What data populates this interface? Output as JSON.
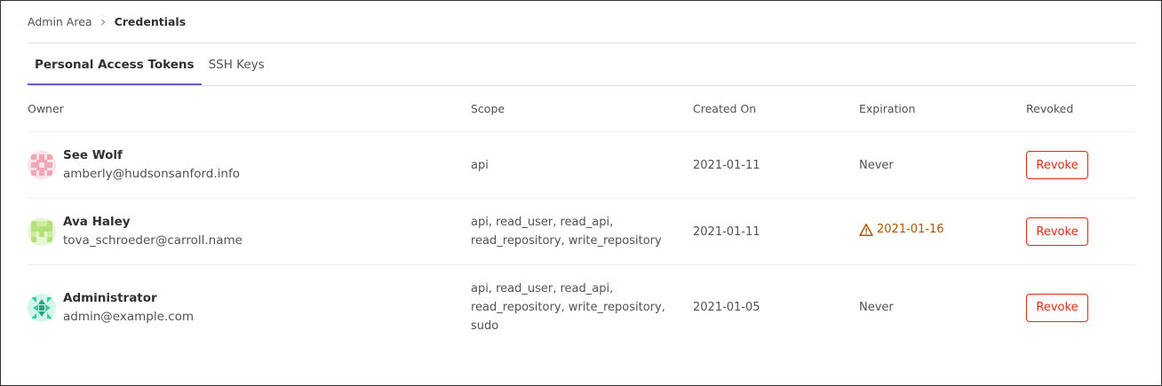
{
  "breadcrumb": {
    "parent": "Admin Area",
    "current": "Credentials"
  },
  "tabs": [
    {
      "label": "Personal Access Tokens",
      "active": true
    },
    {
      "label": "SSH Keys",
      "active": false
    }
  ],
  "table": {
    "headers": {
      "owner": "Owner",
      "scope": "Scope",
      "created_on": "Created On",
      "expiration": "Expiration",
      "revoked": "Revoked"
    },
    "rows": [
      {
        "name": "See Wolf",
        "email": "amberly@hudsonsanford.info",
        "avatar_color": "#f0a6b4",
        "scope_lines": [
          "api"
        ],
        "created_on": "2021-01-11",
        "expiration": "Never",
        "expiration_warning": false,
        "revoke_label": "Revoke"
      },
      {
        "name": "Ava Haley",
        "email": "tova_schroeder@carroll.name",
        "avatar_color": "#b6e07a",
        "scope_lines": [
          "api, read_user, read_api,",
          "read_repository, write_repository"
        ],
        "created_on": "2021-01-11",
        "expiration": "2021-01-16",
        "expiration_warning": true,
        "expiration_icon": "warning-icon",
        "revoke_label": "Revoke"
      },
      {
        "name": "Administrator",
        "email": "admin@example.com",
        "avatar_color": "#2ecfa0",
        "scope_lines": [
          "api, read_user, read_api,",
          "read_repository, write_repository,",
          "sudo"
        ],
        "created_on": "2021-01-05",
        "expiration": "Never",
        "expiration_warning": false,
        "revoke_label": "Revoke"
      }
    ]
  },
  "colors": {
    "tab_active_underline": "#6666c4",
    "revoke": "#dd2b0e",
    "warning": "#b15400"
  }
}
